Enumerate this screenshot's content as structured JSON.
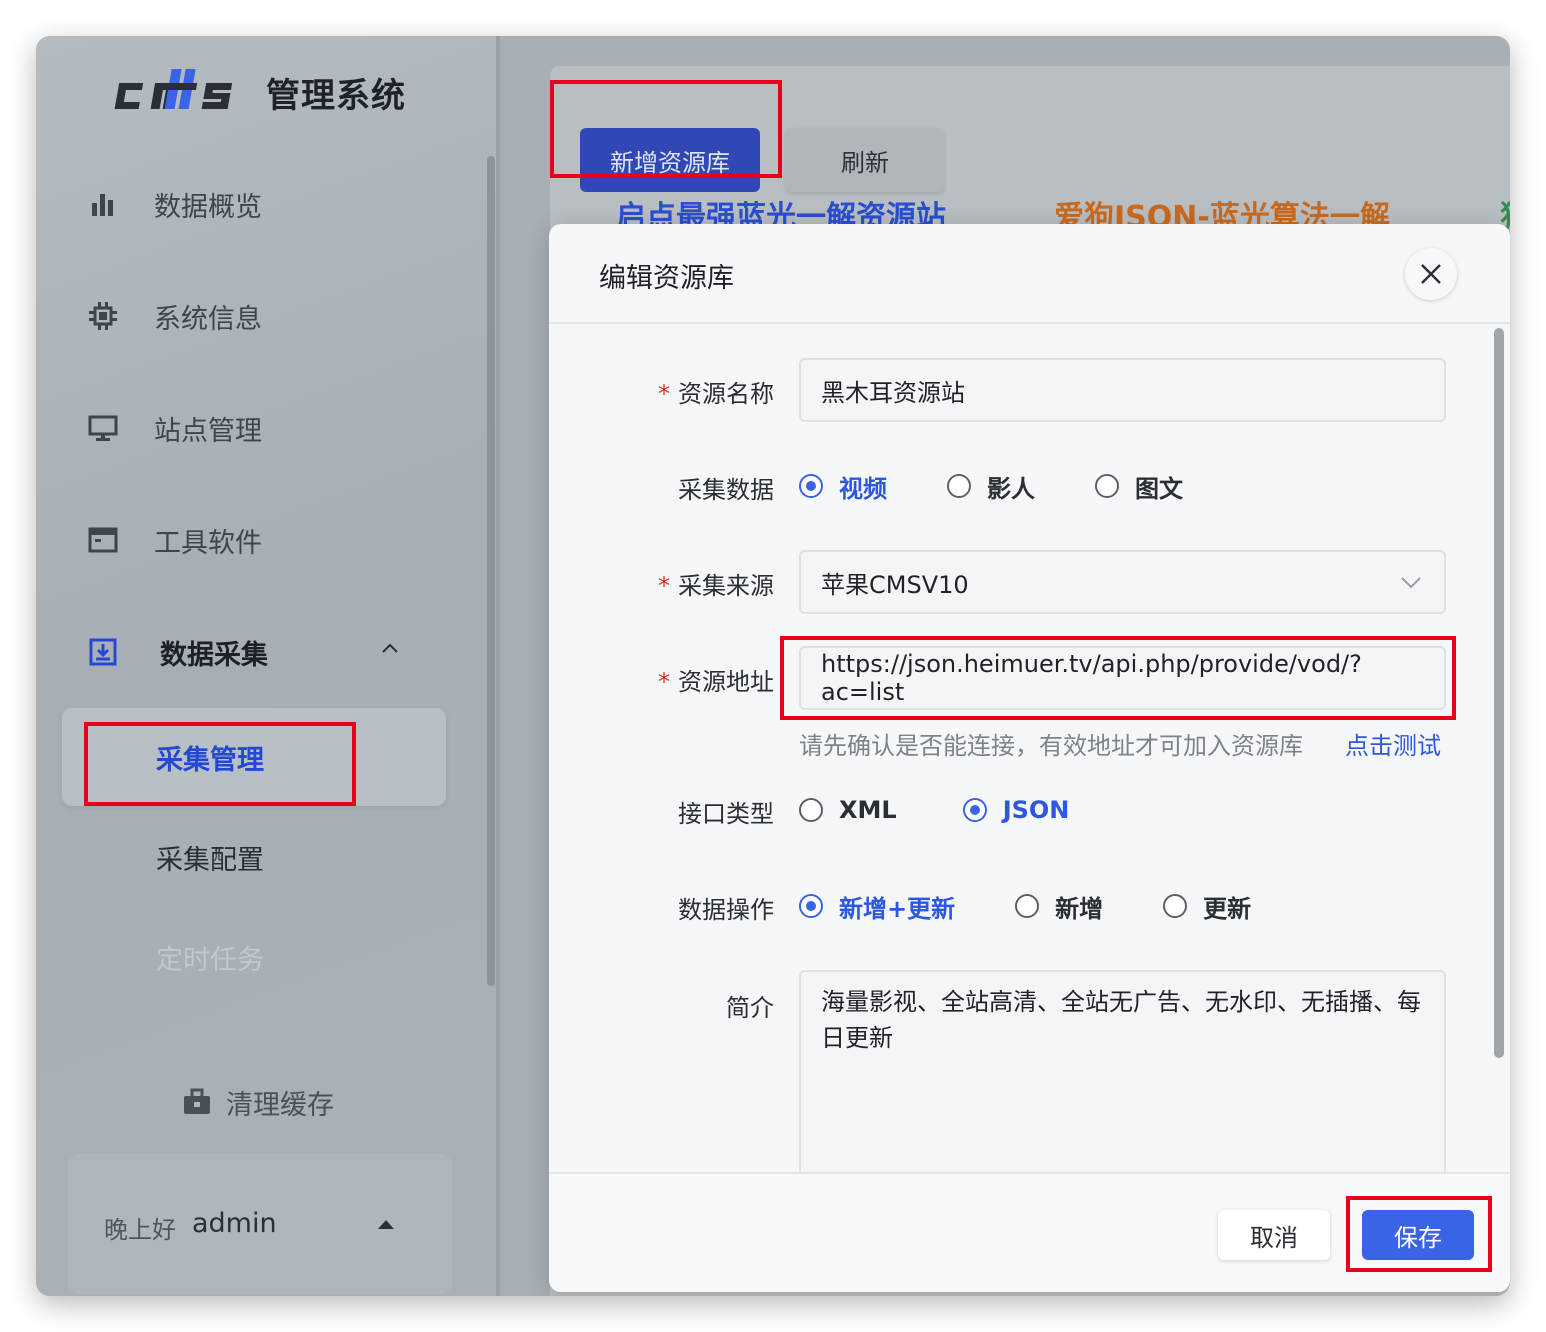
{
  "app": {
    "title": "管理系统",
    "logo_text": "cms"
  },
  "sidebar": {
    "items": [
      {
        "label": "数据概览",
        "icon": "bar-chart-icon"
      },
      {
        "label": "系统信息",
        "icon": "chip-icon"
      },
      {
        "label": "站点管理",
        "icon": "monitor-icon"
      },
      {
        "label": "工具软件",
        "icon": "window-icon"
      }
    ],
    "group": {
      "label": "数据采集",
      "icon": "download-box-icon",
      "expanded": true
    },
    "sub_items": [
      {
        "label": "采集管理",
        "active": true
      },
      {
        "label": "采集配置",
        "active": false
      },
      {
        "label": "定时任务",
        "active": false
      }
    ],
    "clear_cache": {
      "label": "清理缓存",
      "icon": "briefcase-icon"
    },
    "user": {
      "greeting": "晚上好",
      "name": "admin"
    }
  },
  "toolbar": {
    "add_label": "新增资源库",
    "refresh_label": "刷新"
  },
  "background_cards": [
    "启点最强蓝光一解资源站",
    "爱狗JSON-蓝光算法一解",
    "狗"
  ],
  "dialog": {
    "title": "编辑资源库",
    "fields": {
      "name": {
        "label": "资源名称",
        "required": true,
        "value": "黑木耳资源站"
      },
      "collect_data": {
        "label": "采集数据",
        "options": [
          "视频",
          "影人",
          "图文"
        ],
        "selected": "视频"
      },
      "source": {
        "label": "采集来源",
        "required": true,
        "value": "苹果CMSV10"
      },
      "url": {
        "label": "资源地址",
        "required": true,
        "value": "https://json.heimuer.tv/api.php/provide/vod/?ac=list",
        "hint": "请先确认是否能连接，有效地址才可加入资源库",
        "test_label": "点击测试"
      },
      "api_type": {
        "label": "接口类型",
        "options": [
          "XML",
          "JSON"
        ],
        "selected": "JSON"
      },
      "data_op": {
        "label": "数据操作",
        "options": [
          "新增+更新",
          "新增",
          "更新"
        ],
        "selected": "新增+更新"
      },
      "intro": {
        "label": "简介",
        "value": "海量影视、全站高清、全站无广告、无水印、无插播、每日更新"
      }
    },
    "cancel_label": "取消",
    "save_label": "保存"
  },
  "colors": {
    "primary": "#3a63e6",
    "highlight": "#e8001c",
    "required": "#e0362e"
  }
}
